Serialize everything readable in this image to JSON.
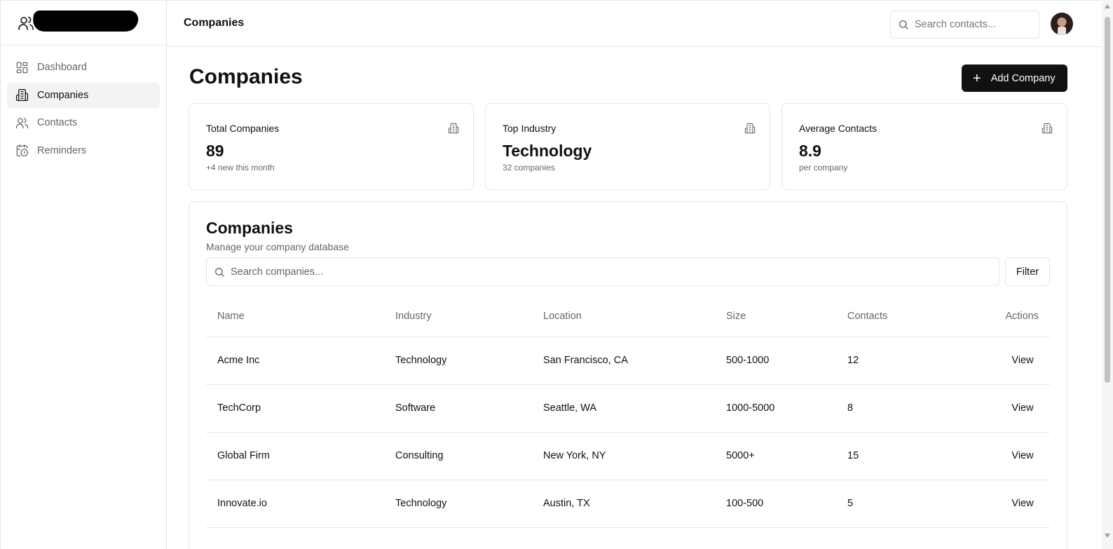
{
  "header": {
    "title": "Companies",
    "search_placeholder": "Search contacts..."
  },
  "sidebar": {
    "items": [
      {
        "label": "Dashboard",
        "icon": "dashboard-icon"
      },
      {
        "label": "Companies",
        "icon": "building-icon",
        "active": true
      },
      {
        "label": "Contacts",
        "icon": "users-icon"
      },
      {
        "label": "Reminders",
        "icon": "calendar-clock-icon"
      }
    ]
  },
  "main": {
    "title": "Companies",
    "add_button_label": "Add Company",
    "stats": [
      {
        "label": "Total Companies",
        "value": "89",
        "sub": "+4 new this month"
      },
      {
        "label": "Top Industry",
        "value": "Technology",
        "sub": "32 companies"
      },
      {
        "label": "Average Contacts",
        "value": "8.9",
        "sub": "per company"
      }
    ],
    "table_card": {
      "title": "Companies",
      "subtitle": "Manage your company database",
      "search_placeholder": "Search companies...",
      "filter_label": "Filter",
      "columns": [
        "Name",
        "Industry",
        "Location",
        "Size",
        "Contacts",
        "Actions"
      ],
      "rows": [
        {
          "name": "Acme Inc",
          "industry": "Technology",
          "location": "San Francisco, CA",
          "size": "500-1000",
          "contacts": "12",
          "action": "View"
        },
        {
          "name": "TechCorp",
          "industry": "Software",
          "location": "Seattle, WA",
          "size": "1000-5000",
          "contacts": "8",
          "action": "View"
        },
        {
          "name": "Global Firm",
          "industry": "Consulting",
          "location": "New York, NY",
          "size": "5000+",
          "contacts": "15",
          "action": "View"
        },
        {
          "name": "Innovate.io",
          "industry": "Technology",
          "location": "Austin, TX",
          "size": "100-500",
          "contacts": "5",
          "action": "View"
        }
      ]
    }
  },
  "colors": {
    "accent": "#111111",
    "border": "#e5e5e5",
    "muted_text": "#666666",
    "active_bg": "#f3f3f3"
  }
}
